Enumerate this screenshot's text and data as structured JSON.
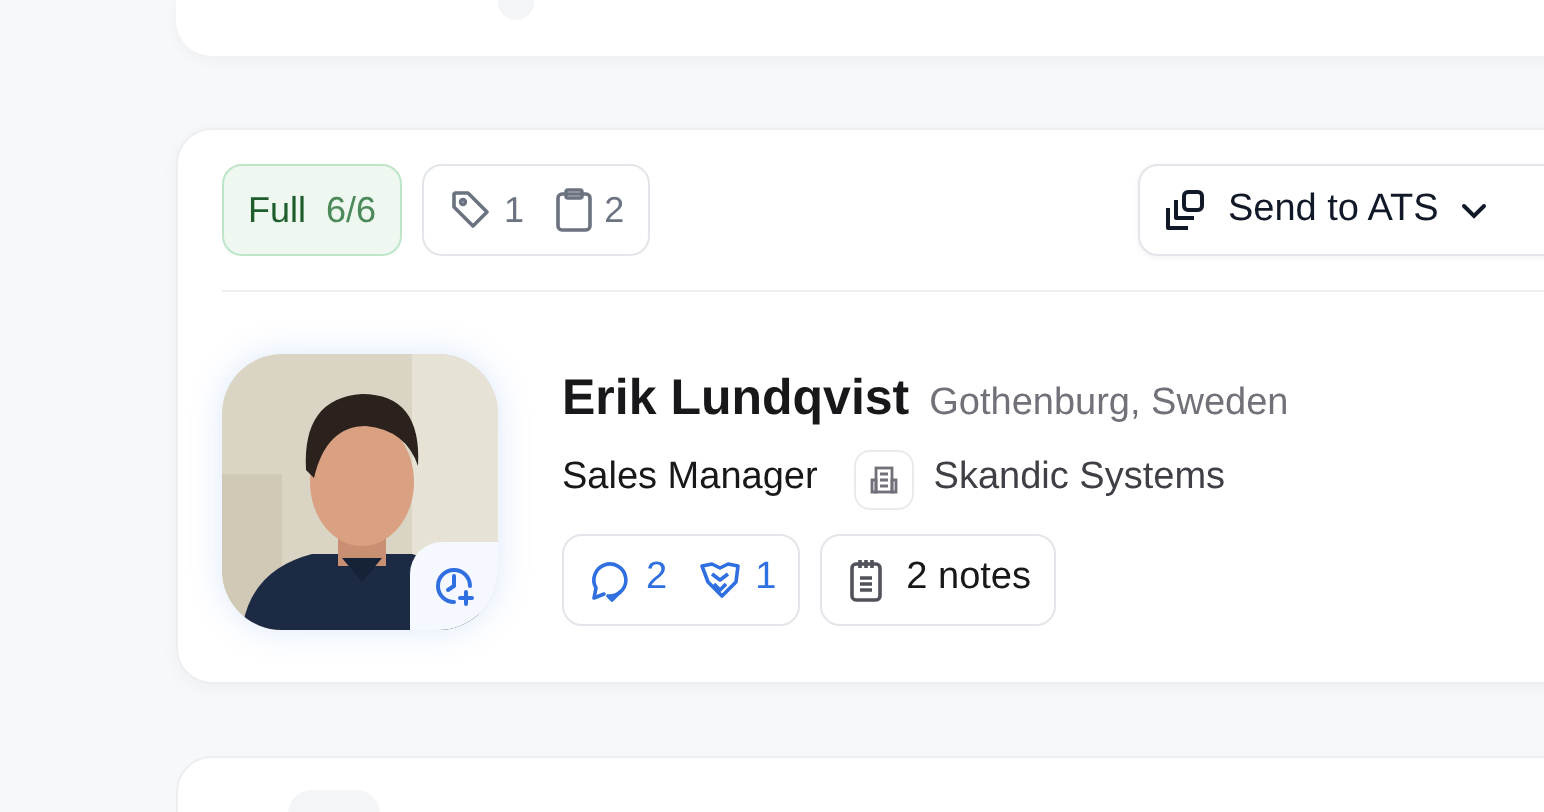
{
  "completeness": {
    "label": "Full",
    "value": "6/6"
  },
  "counts": {
    "tags": "1",
    "clipboards": "2"
  },
  "send_button": {
    "label": "Send to ATS"
  },
  "candidate": {
    "name": "Erik Lundqvist",
    "location": "Gothenburg, Sweden",
    "title": "Sales Manager",
    "company": "Skandic Systems",
    "messages": "2",
    "handshakes": "1",
    "notes": "2 notes"
  }
}
